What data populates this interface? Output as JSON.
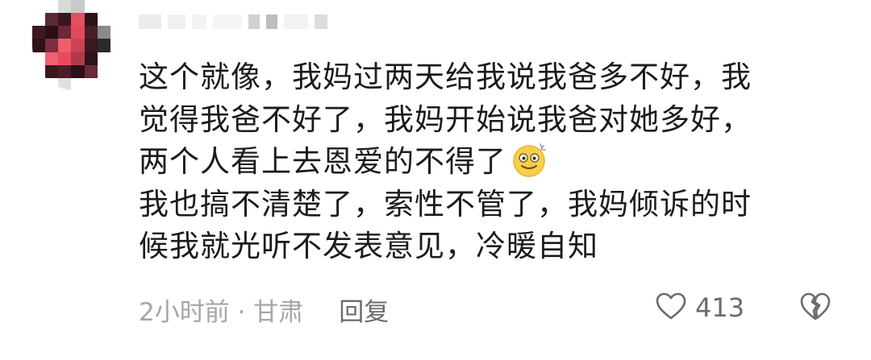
{
  "comment": {
    "lines": [
      "这个就像，我妈过两天给我说我爸多不好，我",
      "觉得我爸不好了，我妈开始说我爸对她多好，",
      "两个人看上去恩爱的不得了",
      "我也搞不清楚了，索性不管了，我妈倾诉的时",
      "候我就光听不发表意见，冷暖自知"
    ],
    "emoji": "dizzy-smile-emoji"
  },
  "footer": {
    "time_location": "2小时前 · 甘肃",
    "reply_label": "回复"
  },
  "actions": {
    "like_count": "413",
    "like_icon": "heart-outline-icon",
    "dislike_icon": "broken-heart-icon"
  },
  "colors": {
    "text": "#1b1b1b",
    "meta": "#a6a6a6",
    "action": "#6b6b6b"
  }
}
